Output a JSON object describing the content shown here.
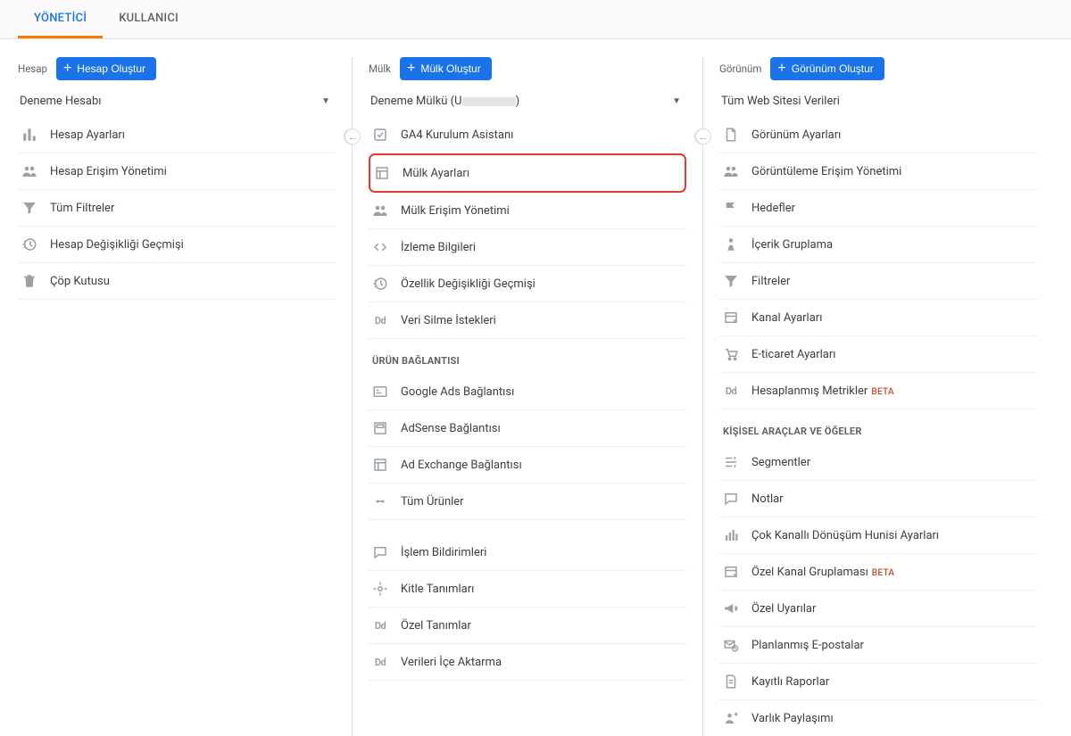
{
  "tabs": {
    "admin": "YÖNETİCİ",
    "user": "KULLANICI"
  },
  "account": {
    "label": "Hesap",
    "create": "Hesap Oluştur",
    "selected": "Deneme Hesabı",
    "items": [
      "Hesap Ayarları",
      "Hesap Erişim Yönetimi",
      "Tüm Filtreler",
      "Hesap Değişikliği Geçmişi",
      "Çöp Kutusu"
    ]
  },
  "property": {
    "label": "Mülk",
    "create": "Mülk Oluştur",
    "selected_prefix": "Deneme Mülkü (U",
    "selected_suffix": ")",
    "items": [
      "GA4 Kurulum Asistanı",
      "Mülk Ayarları",
      "Mülk Erişim Yönetimi",
      "İzleme Bilgileri",
      "Özellik Değişikliği Geçmişi",
      "Veri Silme İstekleri"
    ],
    "linking_head": "ÜRÜN BAĞLANTISI",
    "linking": [
      "Google Ads Bağlantısı",
      "AdSense Bağlantısı",
      "Ad Exchange Bağlantısı",
      "Tüm Ürünler"
    ],
    "misc": [
      "İşlem Bildirimleri",
      "Kitle Tanımları",
      "Özel Tanımlar",
      "Verileri İçe Aktarma"
    ]
  },
  "view": {
    "label": "Görünüm",
    "create": "Görünüm Oluştur",
    "selected": "Tüm Web Sitesi Verileri",
    "items": [
      "Görünüm Ayarları",
      "Görüntüleme Erişim Yönetimi",
      "Hedefler",
      "İçerik Gruplama",
      "Filtreler",
      "Kanal Ayarları",
      "E-ticaret Ayarları",
      "Hesaplanmış Metrikler"
    ],
    "beta_label": "BETA",
    "personal_head": "KİŞİSEL ARAÇLAR VE ÖĞELER",
    "personal": [
      "Segmentler",
      "Notlar",
      "Çok Kanallı Dönüşüm Hunisi Ayarları",
      "Özel Kanal Gruplaması",
      "Özel Uyarılar",
      "Planlanmış E-postalar",
      "Kayıtlı Raporlar",
      "Varlık Paylaşımı"
    ]
  }
}
